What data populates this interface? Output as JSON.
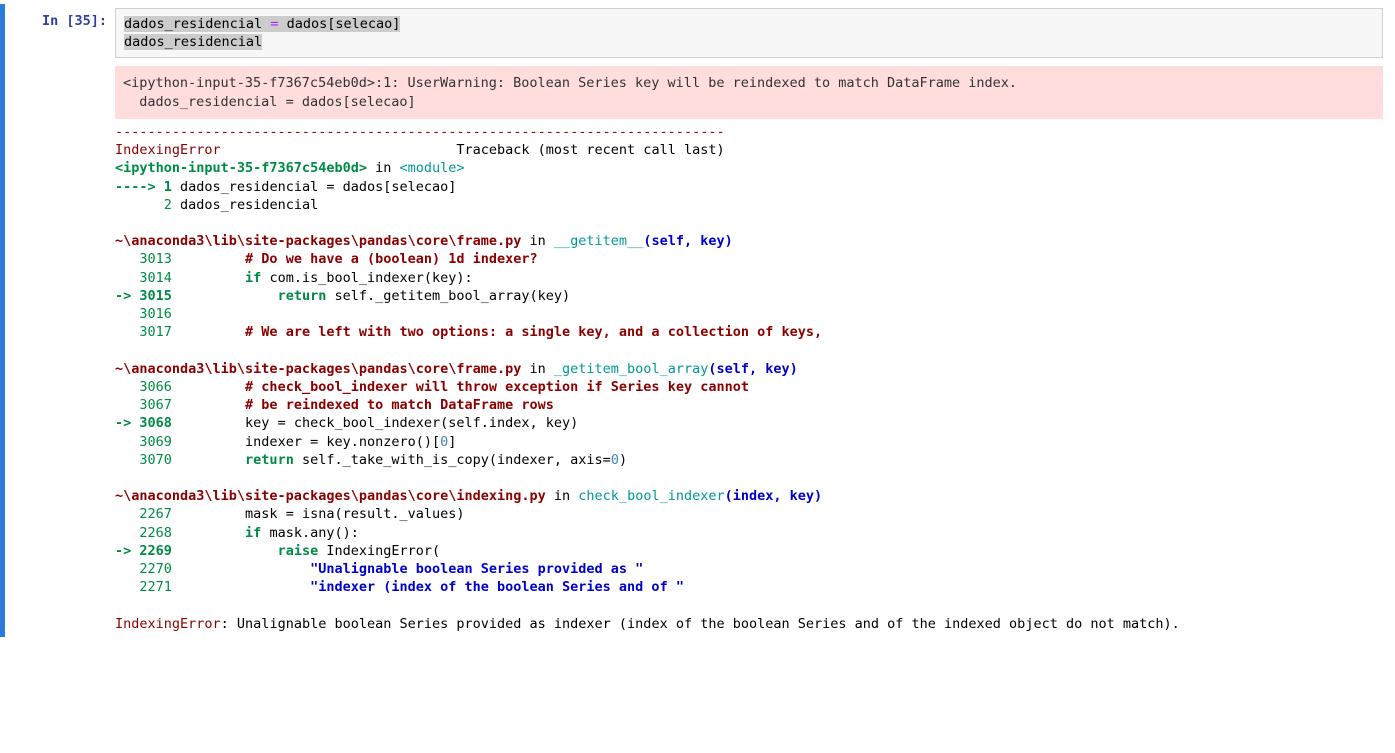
{
  "prompt": "In [35]:",
  "code": {
    "line1": {
      "var1": "dados_residencial",
      "op": " = ",
      "var2": "dados",
      "br1": "[",
      "var3": "selecao",
      "br2": "]"
    },
    "line2": "dados_residencial"
  },
  "warning": {
    "line1": "<ipython-input-35-f7367c54eb0d>:1: UserWarning: Boolean Series key will be reindexed to match DataFrame index.",
    "line2": "  dados_residencial = dados[selecao]"
  },
  "tb": {
    "sep": "---------------------------------------------------------------------------",
    "errname": "IndexingError",
    "tbline": "                             Traceback (most recent call last)",
    "inputref": "<ipython-input-35-f7367c54eb0d>",
    "inword": " in ",
    "module": "<module>",
    "arrow": "----> 1",
    "src1": " dados_residencial = dados[selecao]",
    "ln2": "      2",
    "src2": " dados_residencial",
    "frame1": {
      "path": "~\\anaconda3\\lib\\site-packages\\pandas\\core\\frame.py",
      "in": " in ",
      "fn": "__getitem__",
      "args": "(self, key)",
      "l3013n": "   3013 ",
      "l3013": "        # Do we have a (boolean) 1d indexer?",
      "l3014n": "   3014 ",
      "l3014_if": "        if",
      "l3014_rest": " com.is_bool_indexer(key):",
      "arrow": "-> 3015 ",
      "l3015_ret": "            return",
      "l3015_rest": " self._getitem_bool_array(key)",
      "l3016n": "   3016 ",
      "l3016": "",
      "l3017n": "   3017 ",
      "l3017": "        # We are left with two options: a single key, and a collection of keys,"
    },
    "frame2": {
      "path": "~\\anaconda3\\lib\\site-packages\\pandas\\core\\frame.py",
      "in": " in ",
      "fn": "_getitem_bool_array",
      "args": "(self, key)",
      "l3066n": "   3066 ",
      "l3066": "        # check_bool_indexer will throw exception if Series key cannot",
      "l3067n": "   3067 ",
      "l3067": "        # be reindexed to match DataFrame rows",
      "arrow": "-> 3068 ",
      "l3068": "        key = check_bool_indexer(self.index, key)",
      "l3069n": "   3069 ",
      "l3069_pre": "        indexer = key.nonzero()[",
      "l3069_zero": "0",
      "l3069_post": "]",
      "l3070n": "   3070 ",
      "l3070_ret": "        return",
      "l3070_mid": " self._take_with_is_copy(indexer, axis=",
      "l3070_zero": "0",
      "l3070_end": ")"
    },
    "frame3": {
      "path": "~\\anaconda3\\lib\\site-packages\\pandas\\core\\indexing.py",
      "in": " in ",
      "fn": "check_bool_indexer",
      "args": "(index, key)",
      "l2267n": "   2267 ",
      "l2267": "        mask = isna(result._values)",
      "l2268n": "   2268 ",
      "l2268_if": "        if",
      "l2268_rest": " mask.any():",
      "arrow": "-> 2269 ",
      "l2269_raise": "            raise",
      "l2269_rest": " IndexingError(",
      "l2270n": "   2270 ",
      "l2270": "                \"Unalignable boolean Series provided as \"",
      "l2271n": "   2271 ",
      "l2271": "                \"indexer (index of the boolean Series and of \""
    },
    "final_err": "IndexingError",
    "final_msg": ": Unalignable boolean Series provided as indexer (index of the boolean Series and of the indexed object do not match)."
  }
}
